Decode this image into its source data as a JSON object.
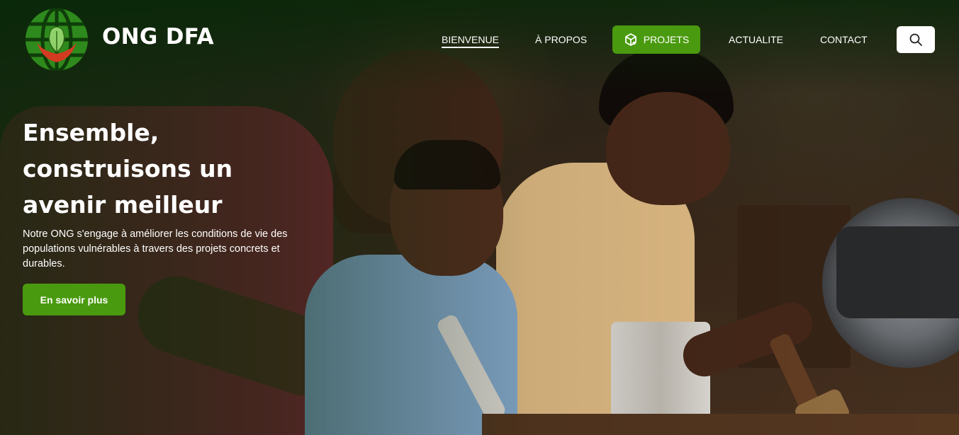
{
  "brand": {
    "name": "ONG DFA",
    "logo_icon": "globe-hands-leaf-icon"
  },
  "nav": {
    "items": [
      {
        "label": "BIENVENUE",
        "active": true
      },
      {
        "label": "À PROPOS",
        "active": false
      },
      {
        "label": "PROJETS",
        "active": false,
        "icon": "cube-icon",
        "highlight": true
      },
      {
        "label": "ACTUALITE",
        "active": false
      },
      {
        "label": "CONTACT",
        "active": false
      }
    ],
    "search_icon": "search-icon"
  },
  "hero": {
    "headline": "Ensemble, construisons un avenir meilleur",
    "lead": "Notre ONG s'engage à améliorer les conditions de vie des populations vulnérables à travers des projets concrets et durables.",
    "cta_label": "En savoir plus",
    "background_image": "family-woodworking-photo"
  },
  "colors": {
    "accent_green": "#4a9a0f",
    "text": "#ffffff",
    "search_bg": "#ffffff"
  }
}
